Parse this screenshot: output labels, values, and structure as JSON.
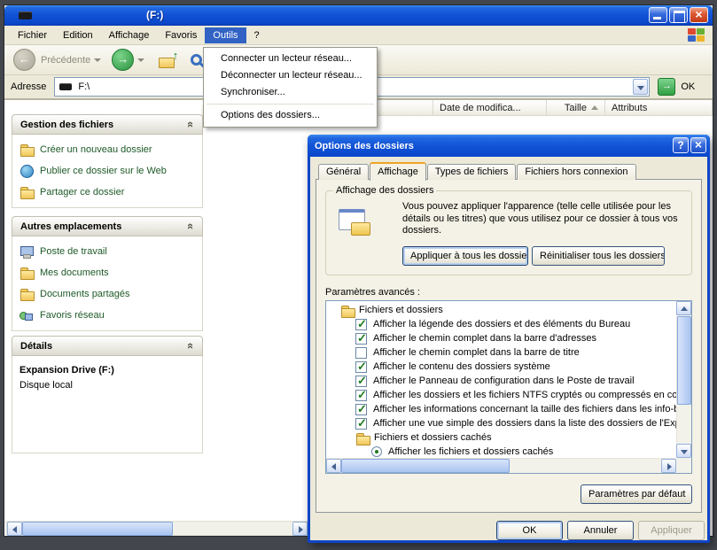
{
  "window": {
    "title": "(F:)"
  },
  "menubar": {
    "items": [
      {
        "label": "Fichier"
      },
      {
        "label": "Edition"
      },
      {
        "label": "Affichage"
      },
      {
        "label": "Favoris"
      },
      {
        "label": "Outils"
      },
      {
        "label": "?"
      }
    ]
  },
  "toolbar": {
    "back_label": "Précédente"
  },
  "address": {
    "label": "Adresse",
    "value": "F:\\",
    "go_label": "OK"
  },
  "filelist": {
    "columns": [
      {
        "label": "Date de modifica..."
      },
      {
        "label": "Taille"
      },
      {
        "label": "Attributs"
      }
    ]
  },
  "tools_menu": {
    "items": [
      "Connecter un lecteur réseau...",
      "Déconnecter un lecteur réseau...",
      "Synchroniser...",
      "Options des dossiers..."
    ]
  },
  "sidebar": {
    "panes": [
      {
        "title": "Gestion des fichiers",
        "items": [
          "Créer un nouveau dossier",
          "Publier ce dossier sur le Web",
          "Partager ce dossier"
        ]
      },
      {
        "title": "Autres emplacements",
        "items": [
          "Poste de travail",
          "Mes documents",
          "Documents partagés",
          "Favoris réseau"
        ]
      },
      {
        "title": "Détails"
      }
    ],
    "details": {
      "title": "Expansion Drive (F:)",
      "subtitle": "Disque local"
    }
  },
  "dialog": {
    "title": "Options des dossiers",
    "tabs": [
      "Général",
      "Affichage",
      "Types de fichiers",
      "Fichiers hors connexion"
    ],
    "active_tab": "Affichage",
    "folder_views": {
      "legend": "Affichage des dossiers",
      "text": "Vous pouvez appliquer l'apparence (telle celle utilisée pour les détails ou les titres) que vous utilisez pour ce dossier à tous vos dossiers.",
      "apply_label": "Appliquer à tous les dossiers",
      "reset_label": "Réinitialiser tous les dossiers"
    },
    "advanced": {
      "label": "Paramètres avancés :",
      "items": [
        {
          "type": "group",
          "label": "Fichiers et dossiers"
        },
        {
          "type": "checkbox",
          "checked": true,
          "label": "Afficher la légende des dossiers et des éléments du Bureau"
        },
        {
          "type": "checkbox",
          "checked": true,
          "label": "Afficher le chemin complet dans la barre d'adresses"
        },
        {
          "type": "checkbox",
          "checked": false,
          "label": "Afficher le chemin complet dans la barre de titre"
        },
        {
          "type": "checkbox",
          "checked": true,
          "label": "Afficher le contenu des dossiers système"
        },
        {
          "type": "checkbox",
          "checked": true,
          "label": "Afficher le Panneau de configuration dans le Poste de travail"
        },
        {
          "type": "checkbox",
          "checked": true,
          "label": "Afficher les dossiers et les fichiers NTFS cryptés ou compressés en couleur"
        },
        {
          "type": "checkbox",
          "checked": true,
          "label": "Afficher les informations concernant la taille des fichiers dans les info-bulles des dossiers"
        },
        {
          "type": "checkbox",
          "checked": true,
          "label": "Afficher une vue simple des dossiers dans la liste des dossiers de l'Explorateur"
        },
        {
          "type": "group",
          "label": "Fichiers et dossiers cachés"
        },
        {
          "type": "radio",
          "checked": true,
          "label": "Afficher les fichiers et dossiers cachés"
        }
      ]
    },
    "default_button": "Paramètres par défaut",
    "buttons": {
      "ok": "OK",
      "cancel": "Annuler",
      "apply": "Appliquer"
    }
  }
}
